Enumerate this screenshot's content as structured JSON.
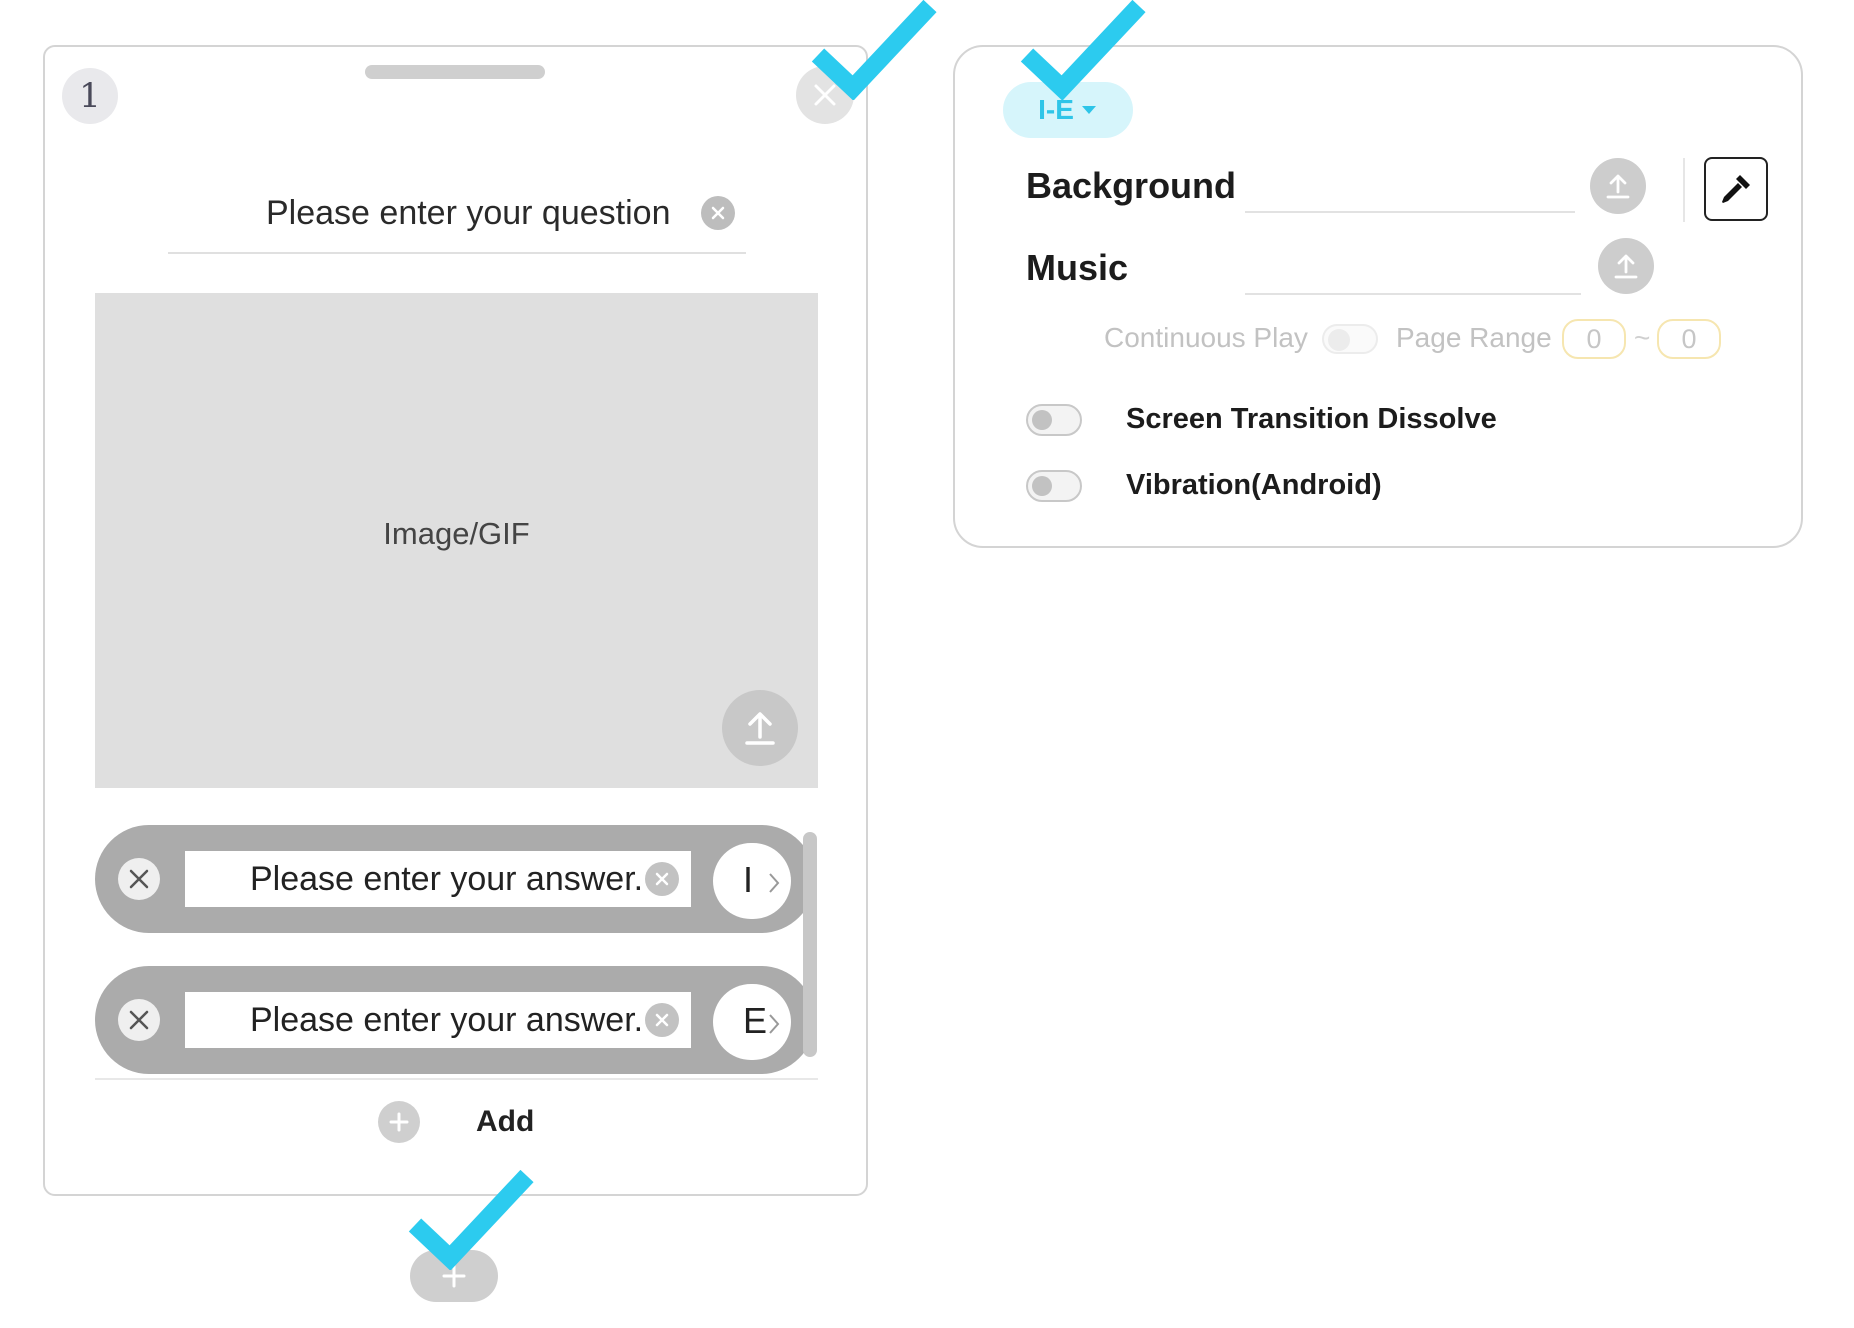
{
  "question_card": {
    "page_number": "1",
    "question_placeholder": "Please enter your question",
    "image_label": "Image/GIF",
    "answers": [
      {
        "placeholder": "Please enter your answer.",
        "tag": "I"
      },
      {
        "placeholder": "Please enter your answer.",
        "tag": "E"
      }
    ],
    "add_label": "Add"
  },
  "settings": {
    "type_dropdown": "I-E",
    "background_label": "Background",
    "music_label": "Music",
    "continuous_play_label": "Continuous Play",
    "page_range_label": "Page Range",
    "page_range_from": "0",
    "page_range_separator": "~",
    "page_range_to": "0",
    "options": [
      {
        "label": "Screen Transition Dissolve",
        "enabled": false
      },
      {
        "label": "Vibration(Android)",
        "enabled": false
      }
    ]
  },
  "colors": {
    "accent_check": "#2ccbef",
    "dropdown_bg": "#d6f5fb",
    "answer_pill": "#ababab"
  }
}
